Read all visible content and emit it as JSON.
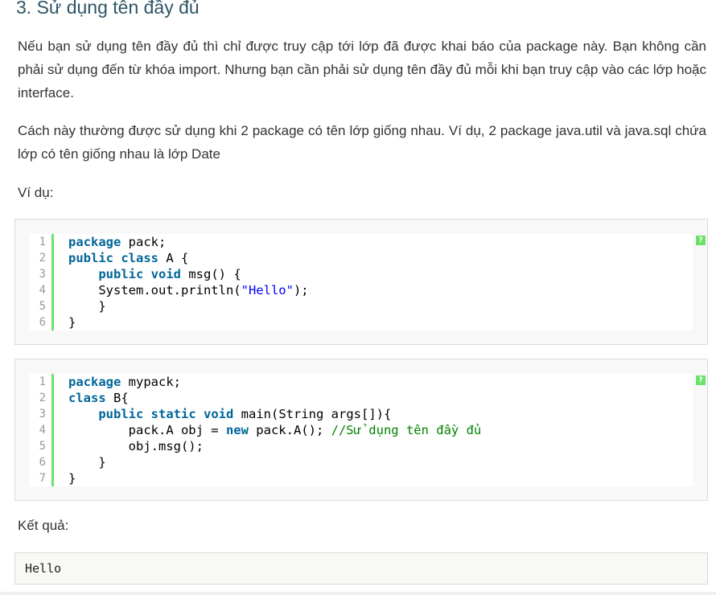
{
  "heading": "3. Sử dụng tên đầy đủ",
  "paragraph1": "Nếu bạn sử dụng tên đầy đủ thì chỉ được truy cập tới lớp đã được khai báo của package này. Bạn không cần phải sử dụng đến từ khóa import. Nhưng bạn cần phải sử dụng tên đầy đủ mỗi khi bạn truy cập vào các lớp hoặc interface.",
  "paragraph2": "Cách này thường được sử dụng khi 2 package có tên lớp giống nhau. Ví dụ, 2 package java.util và java.sql chứa lớp có tên giống nhau là lớp Date",
  "example_label": "Ví dụ:",
  "help_icon_text": "?",
  "code1": {
    "line_numbers": [
      "1",
      "2",
      "3",
      "4",
      "5",
      "6"
    ],
    "lines": [
      [
        {
          "t": "package",
          "c": "kw"
        },
        {
          "t": " pack;",
          "c": ""
        }
      ],
      [
        {
          "t": "public",
          "c": "kw"
        },
        {
          "t": " ",
          "c": ""
        },
        {
          "t": "class",
          "c": "kw"
        },
        {
          "t": " A {",
          "c": ""
        }
      ],
      [
        {
          "t": "    ",
          "c": ""
        },
        {
          "t": "public",
          "c": "kw"
        },
        {
          "t": " ",
          "c": ""
        },
        {
          "t": "void",
          "c": "kw"
        },
        {
          "t": " msg() {",
          "c": ""
        }
      ],
      [
        {
          "t": "    System.out.println(",
          "c": ""
        },
        {
          "t": "\"Hello\"",
          "c": "str"
        },
        {
          "t": ");",
          "c": ""
        }
      ],
      [
        {
          "t": "    }",
          "c": ""
        }
      ],
      [
        {
          "t": "}",
          "c": ""
        }
      ]
    ]
  },
  "code2": {
    "line_numbers": [
      "1",
      "2",
      "3",
      "4",
      "5",
      "6",
      "7"
    ],
    "lines": [
      [
        {
          "t": "package",
          "c": "kw"
        },
        {
          "t": " mypack;",
          "c": ""
        }
      ],
      [
        {
          "t": "class",
          "c": "kw"
        },
        {
          "t": " B{",
          "c": ""
        }
      ],
      [
        {
          "t": "    ",
          "c": ""
        },
        {
          "t": "public",
          "c": "kw"
        },
        {
          "t": " ",
          "c": ""
        },
        {
          "t": "static",
          "c": "kw"
        },
        {
          "t": " ",
          "c": ""
        },
        {
          "t": "void",
          "c": "kw"
        },
        {
          "t": " main(String args[]){",
          "c": ""
        }
      ],
      [
        {
          "t": "        pack.A obj = ",
          "c": ""
        },
        {
          "t": "new",
          "c": "kw"
        },
        {
          "t": " pack.A(); ",
          "c": ""
        },
        {
          "t": "//Sử dụng tên đầy đủ",
          "c": "com"
        }
      ],
      [
        {
          "t": "        obj.msg();",
          "c": ""
        }
      ],
      [
        {
          "t": "    }",
          "c": ""
        }
      ],
      [
        {
          "t": "}",
          "c": ""
        }
      ]
    ]
  },
  "result_label": "Kết quả:",
  "output_text": "Hello",
  "colors": {
    "heading": "#2d5565",
    "keyword": "#006699",
    "string": "#0000ff",
    "comment": "#008200",
    "gutter_bar": "#6ce26c"
  }
}
